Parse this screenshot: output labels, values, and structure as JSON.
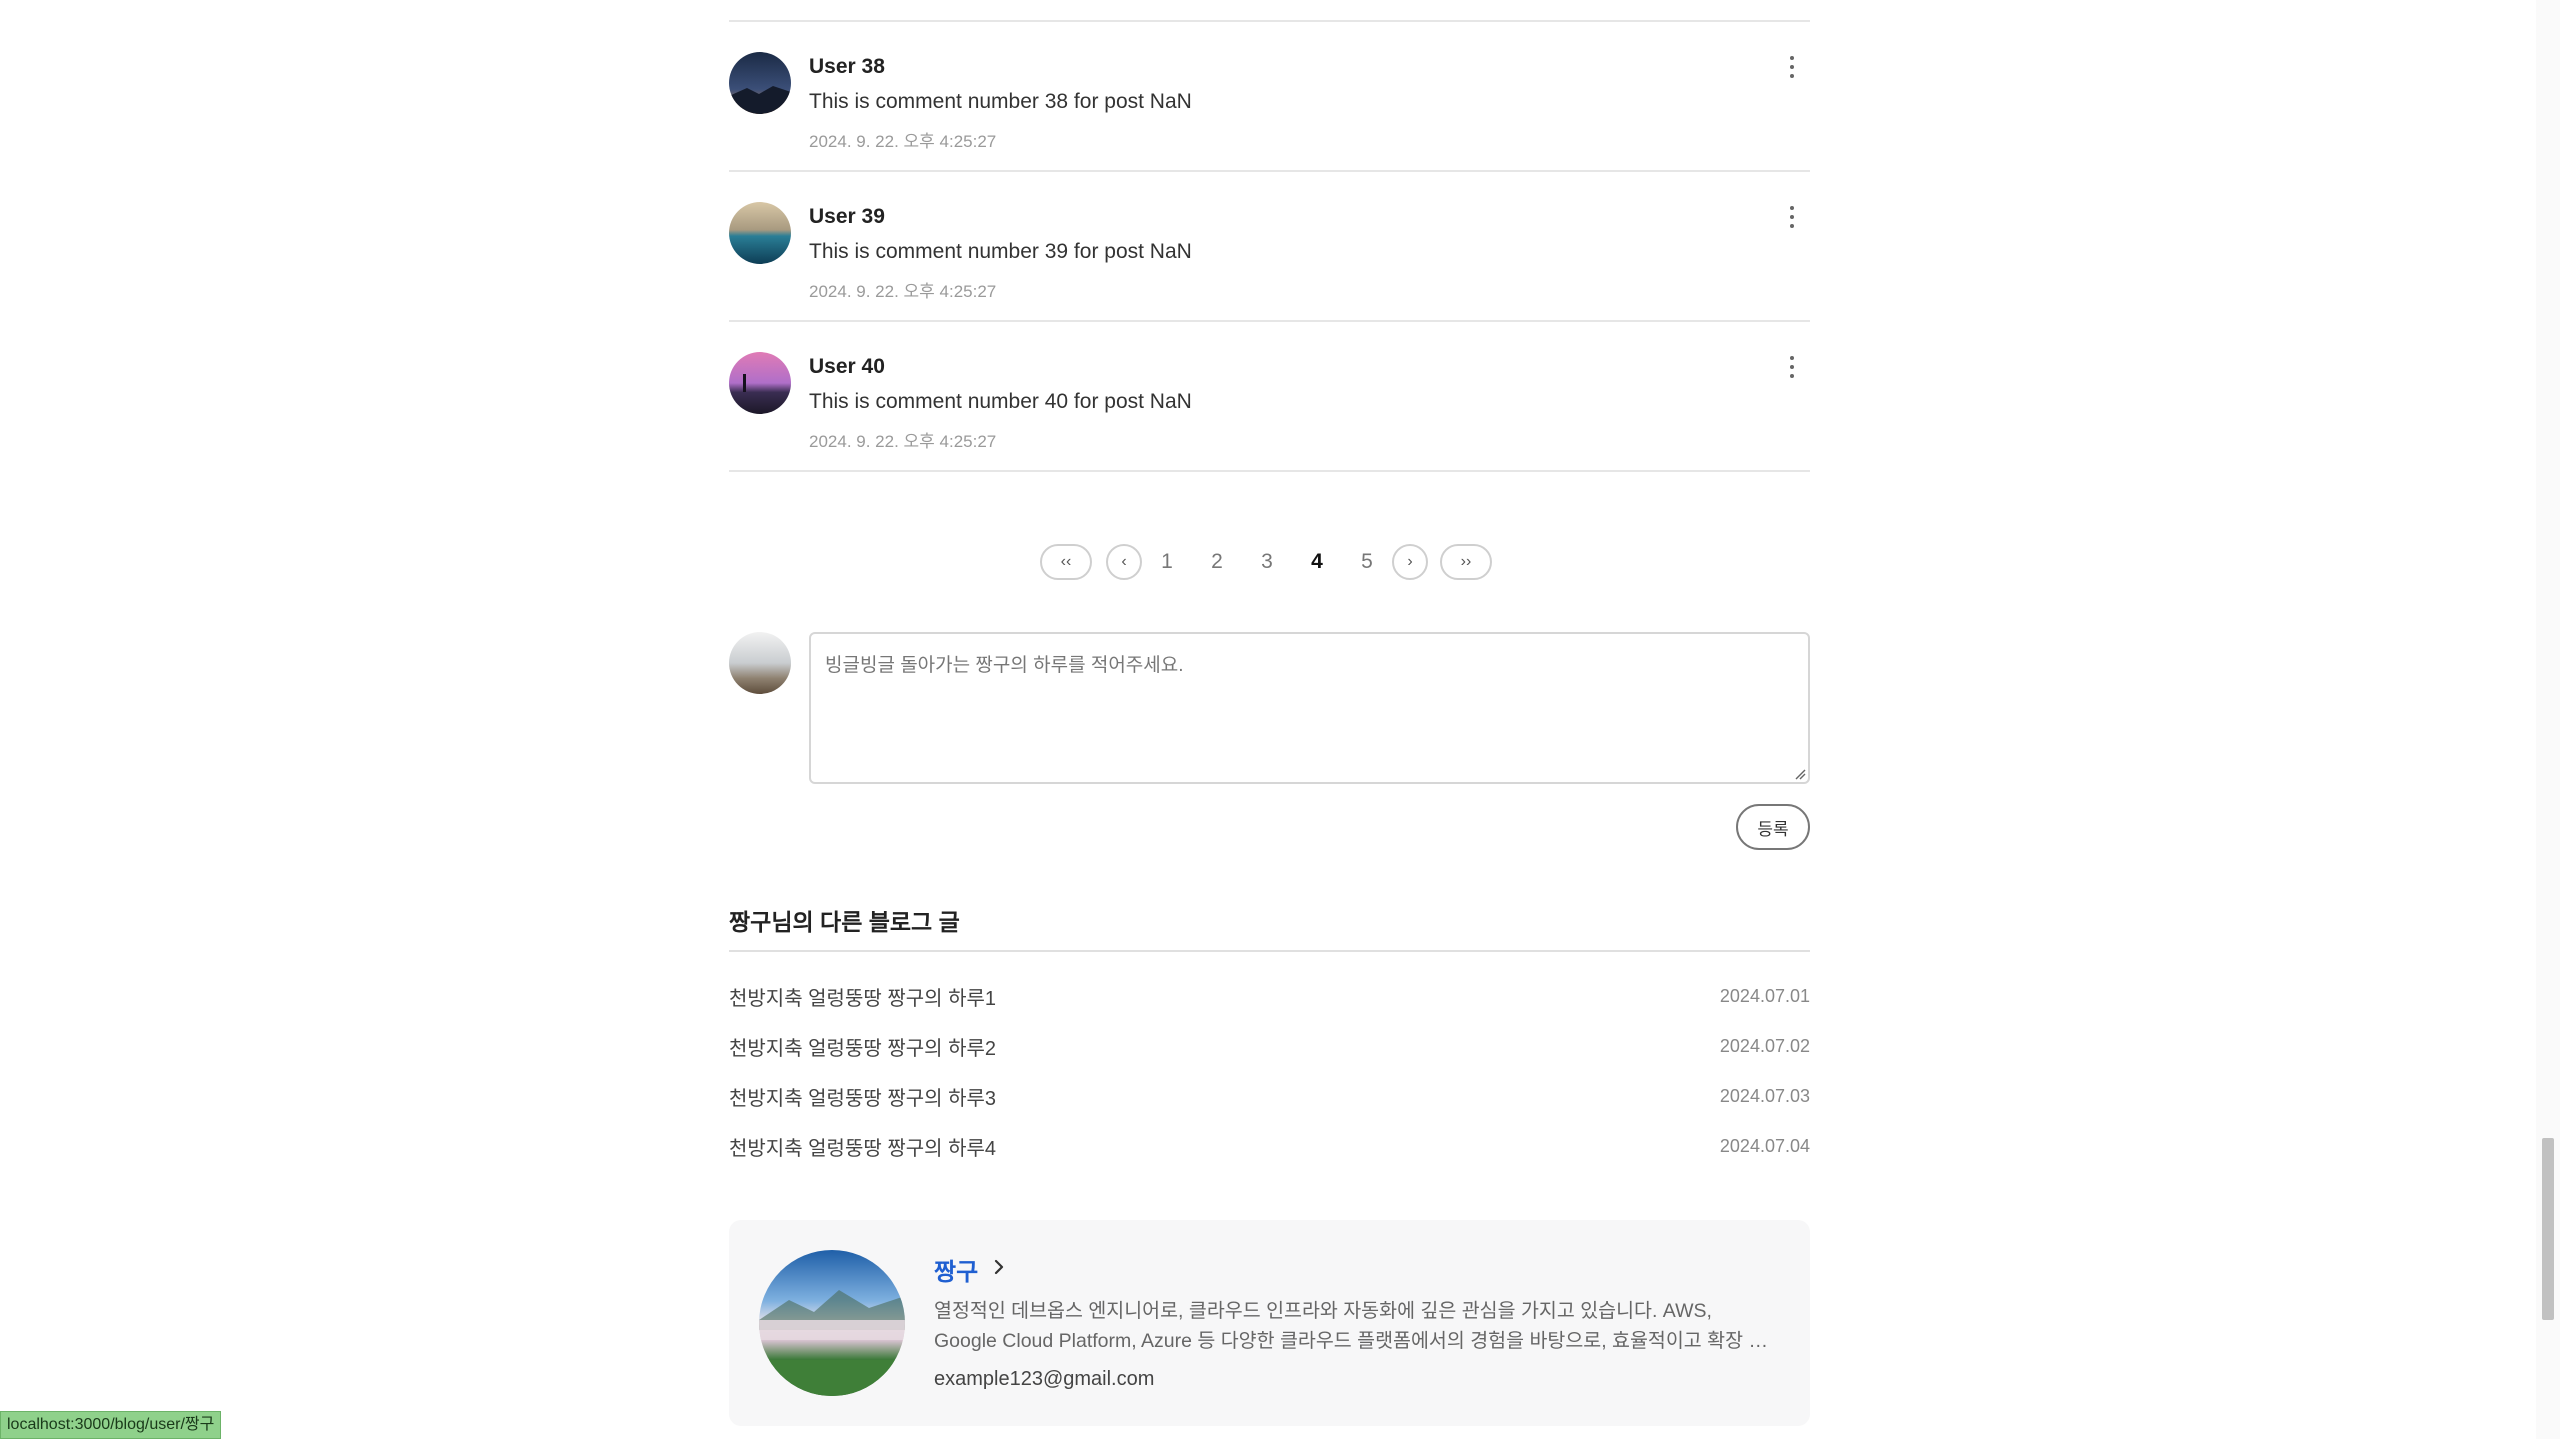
{
  "comments": [
    {
      "author": "User 38",
      "text": "This is comment number 38 for post NaN",
      "time": "2024. 9. 22. 오후 4:25:27"
    },
    {
      "author": "User 39",
      "text": "This is comment number 39 for post NaN",
      "time": "2024. 9. 22. 오후 4:25:27"
    },
    {
      "author": "User 40",
      "text": "This is comment number 40 for post NaN",
      "time": "2024. 9. 22. 오후 4:25:27"
    }
  ],
  "pagination": {
    "first": "‹‹",
    "prev": "‹",
    "next": "›",
    "last": "››",
    "pages": [
      "1",
      "2",
      "3",
      "4",
      "5"
    ],
    "current": "4"
  },
  "comment_form": {
    "placeholder": "빙글빙글 돌아가는 짱구의 하루를 적어주세요.",
    "submit_label": "등록"
  },
  "other_posts": {
    "title": "짱구님의 다른 블로그 글",
    "items": [
      {
        "title": "천방지축 얼렁뚱땅 짱구의 하루1",
        "date": "2024.07.01"
      },
      {
        "title": "천방지축 얼렁뚱땅 짱구의 하루2",
        "date": "2024.07.02"
      },
      {
        "title": "천방지축 얼렁뚱땅 짱구의 하루3",
        "date": "2024.07.03"
      },
      {
        "title": "천방지축 얼렁뚱땅 짱구의 하루4",
        "date": "2024.07.04"
      }
    ]
  },
  "profile": {
    "name": "짱구",
    "bio": "열정적인 데브옵스 엔지니어로, 클라우드 인프라와 자동화에 깊은 관심을 가지고 있습니다. AWS, Google Cloud Platform, Azure 등 다양한 클라우드 플랫폼에서의 경험을 바탕으로, 효율적이고 확장 가능한 시스템을 구축하고 운영합니다.",
    "email": "example123@gmail.com"
  },
  "status_bar": {
    "url": "localhost:3000/blog/user/짱구"
  },
  "colors": {
    "link": "#1f5fd1",
    "divider": "#e6e6e6",
    "status_bg": "#8fd18b"
  }
}
